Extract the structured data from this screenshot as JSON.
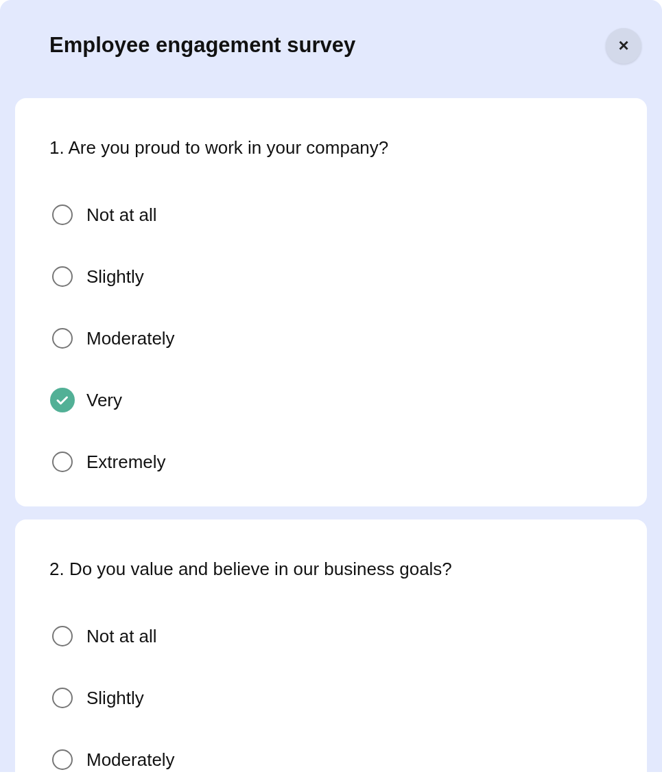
{
  "title": "Employee engagement survey",
  "close_button": {
    "label": "×"
  },
  "questions": [
    {
      "text": "1. Are you proud to work in your company?",
      "options": [
        {
          "label": "Not at all",
          "selected": false
        },
        {
          "label": "Slightly",
          "selected": false
        },
        {
          "label": "Moderately",
          "selected": false
        },
        {
          "label": "Very",
          "selected": true
        },
        {
          "label": "Extremely",
          "selected": false
        }
      ]
    },
    {
      "text": "2. Do you value and believe in our business goals?",
      "options": [
        {
          "label": "Not at all",
          "selected": false
        },
        {
          "label": "Slightly",
          "selected": false
        },
        {
          "label": "Moderately",
          "selected": false
        }
      ]
    }
  ]
}
